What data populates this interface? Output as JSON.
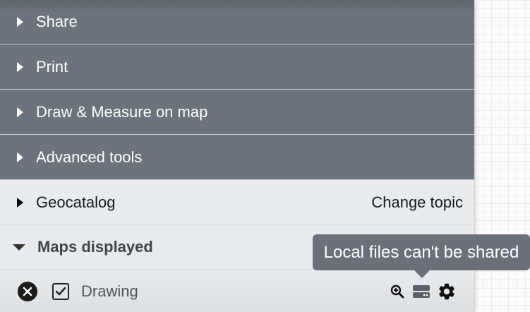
{
  "menu": {
    "sections": [
      {
        "label": "Share"
      },
      {
        "label": "Print"
      },
      {
        "label": "Draw & Measure on map"
      },
      {
        "label": "Advanced tools"
      }
    ],
    "geocatalog": {
      "label": "Geocatalog",
      "change_topic": "Change topic"
    },
    "maps_displayed": {
      "label": "Maps displayed"
    }
  },
  "layer": {
    "name": "Drawing",
    "checked": true,
    "tools": [
      "zoom-to-extent-icon",
      "local-file-icon",
      "gear-icon"
    ]
  },
  "tooltip": {
    "text": "Local files can't be shared"
  },
  "colors": {
    "section_bg": "#6b737c",
    "light_bg": "#e7ebef",
    "tooltip_bg": "#697079"
  }
}
